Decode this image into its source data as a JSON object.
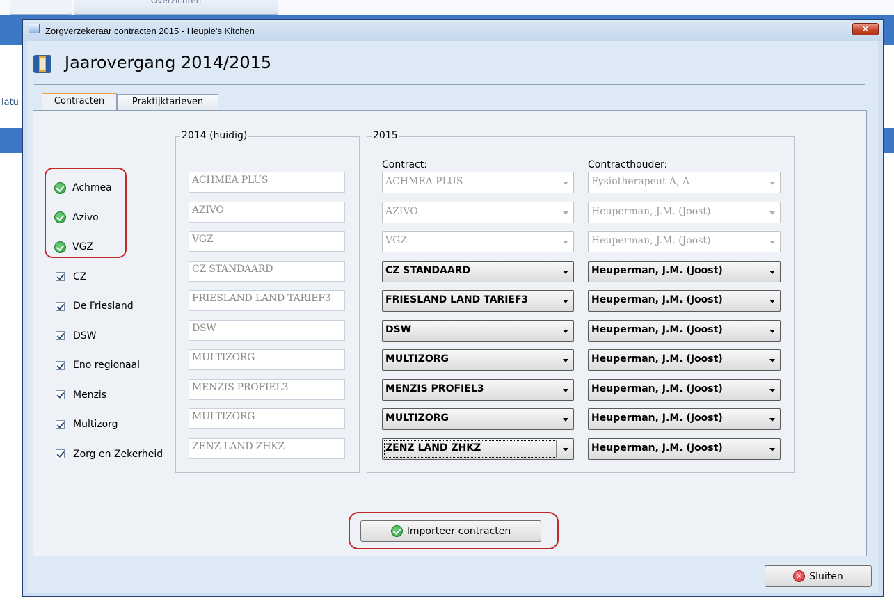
{
  "background": {
    "top_tab_label": "Overzichten",
    "side_text": "latu"
  },
  "window": {
    "title": "Zorgverzekeraar contracten 2015 - Heupie's Kitchen",
    "close_label": "✕"
  },
  "header": {
    "title": "Jaarovergang 2014/2015"
  },
  "tabs": [
    {
      "label": "Contracten"
    },
    {
      "label": "Praktijktarieven"
    }
  ],
  "insurers": [
    {
      "name": "Achmea",
      "status": "imported"
    },
    {
      "name": "Azivo",
      "status": "imported"
    },
    {
      "name": "VGZ",
      "status": "imported"
    },
    {
      "name": "CZ",
      "status": "checked"
    },
    {
      "name": "De Friesland",
      "status": "checked"
    },
    {
      "name": "DSW",
      "status": "checked"
    },
    {
      "name": "Eno regionaal",
      "status": "checked"
    },
    {
      "name": "Menzis",
      "status": "checked"
    },
    {
      "name": "Multizorg",
      "status": "checked"
    },
    {
      "name": "Zorg en Zekerheid",
      "status": "checked"
    }
  ],
  "group_2014": {
    "label": "2014 (huidig)",
    "values": [
      "ACHMEA PLUS",
      "AZIVO",
      "VGZ",
      "CZ STANDAARD",
      "FRIESLAND LAND TARIEF3",
      "DSW",
      "MULTIZORG",
      "MENZIS PROFIEL3",
      "MULTIZORG",
      "ZENZ LAND ZHKZ"
    ]
  },
  "group_2015": {
    "label": "2015",
    "contract_header": "Contract:",
    "holder_header": "Contracthouder:",
    "rows": [
      {
        "contract": "ACHMEA PLUS",
        "holder": "Fysiotherapeut A, A",
        "disabled": true
      },
      {
        "contract": "AZIVO",
        "holder": "Heuperman, J.M.  (Joost)",
        "disabled": true
      },
      {
        "contract": "VGZ",
        "holder": "Heuperman, J.M.  (Joost)",
        "disabled": true
      },
      {
        "contract": "CZ STANDAARD",
        "holder": "Heuperman, J.M.  (Joost)",
        "disabled": false
      },
      {
        "contract": "FRIESLAND LAND TARIEF3",
        "holder": "Heuperman, J.M.  (Joost)",
        "disabled": false
      },
      {
        "contract": "DSW",
        "holder": "Heuperman, J.M.  (Joost)",
        "disabled": false
      },
      {
        "contract": "MULTIZORG",
        "holder": "Heuperman, J.M.  (Joost)",
        "disabled": false
      },
      {
        "contract": "MENZIS PROFIEL3",
        "holder": "Heuperman, J.M.  (Joost)",
        "disabled": false
      },
      {
        "contract": "MULTIZORG",
        "holder": "Heuperman, J.M.  (Joost)",
        "disabled": false
      },
      {
        "contract": "ZENZ LAND ZHKZ",
        "holder": "Heuperman, J.M.  (Joost)",
        "disabled": false
      }
    ]
  },
  "buttons": {
    "import_label": "Importeer contracten",
    "close_label": "Sluiten"
  },
  "colors": {
    "highlight": "#c62828",
    "dialog_bg": "#dde9f5",
    "accent": "#3d78c6"
  }
}
